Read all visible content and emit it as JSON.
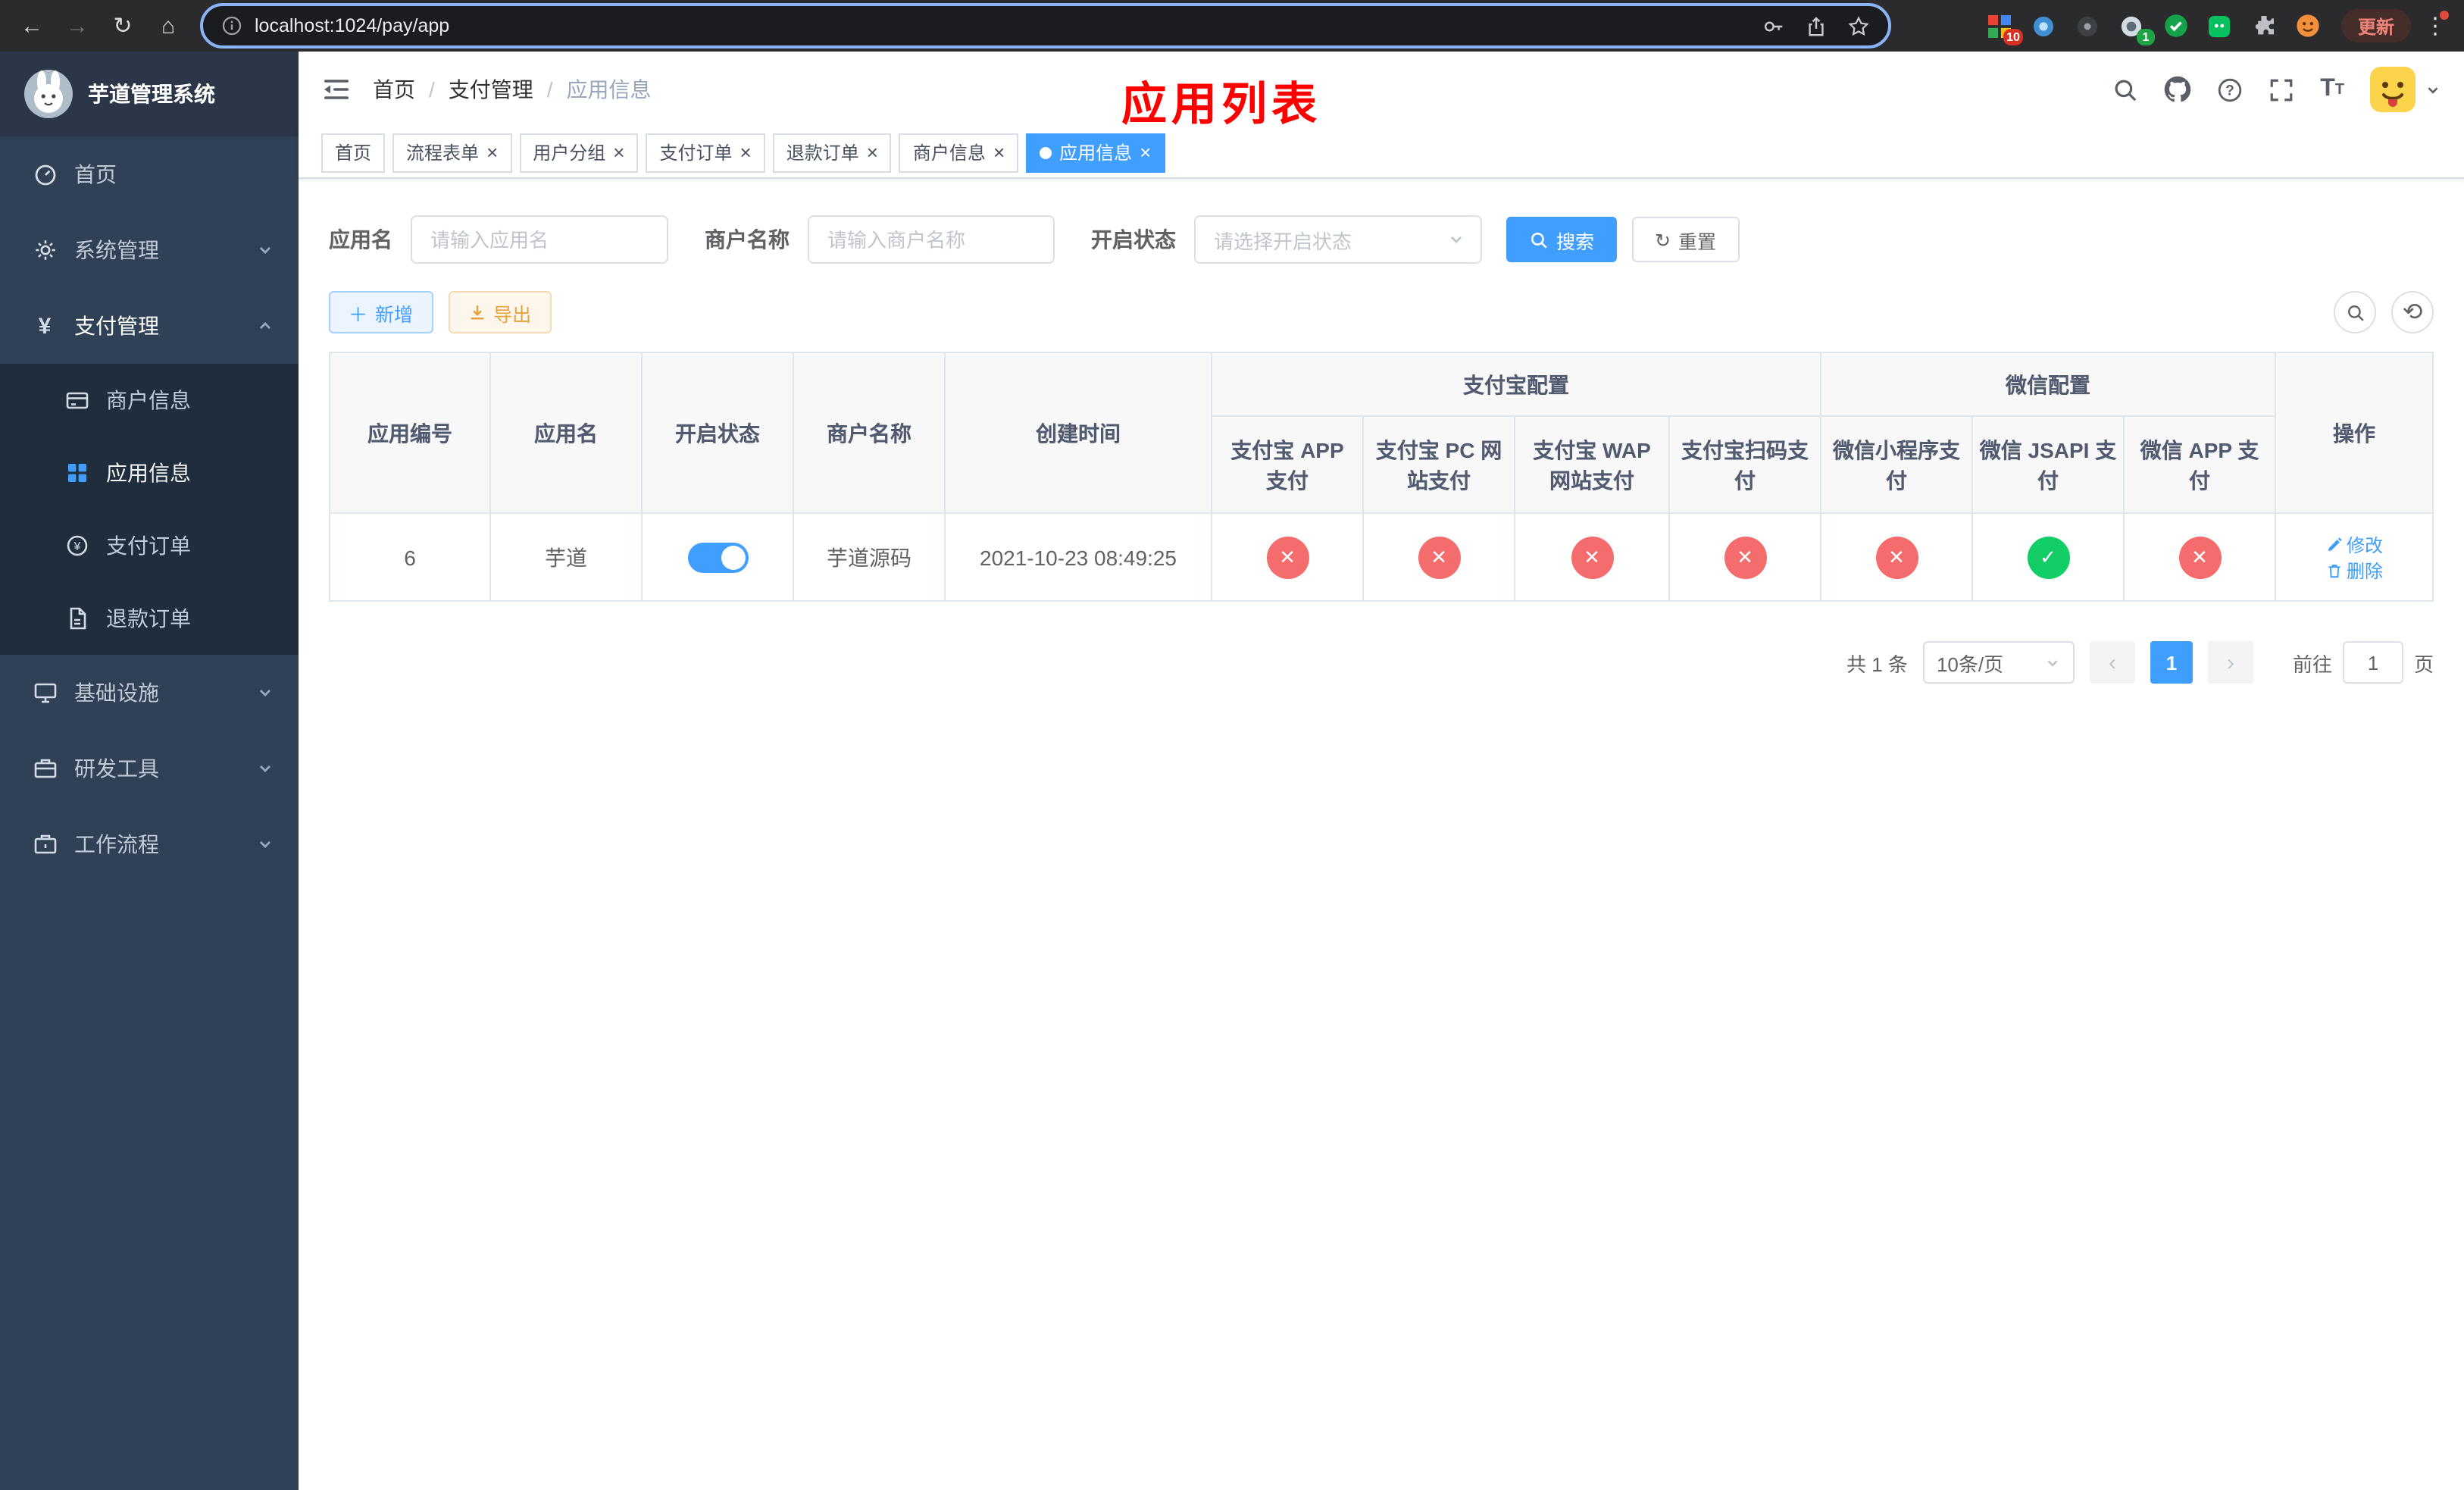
{
  "browser": {
    "url": "localhost:1024/pay/app",
    "update_button": "更新",
    "ext_badge_red": "10",
    "ext_badge_green": "1"
  },
  "sidebar": {
    "app_title": "芋道管理系统",
    "items": [
      {
        "label": "首页"
      },
      {
        "label": "系统管理"
      },
      {
        "label": "支付管理",
        "children": [
          {
            "label": "商户信息"
          },
          {
            "label": "应用信息"
          },
          {
            "label": "支付订单"
          },
          {
            "label": "退款订单"
          }
        ]
      },
      {
        "label": "基础设施"
      },
      {
        "label": "研发工具"
      },
      {
        "label": "工作流程"
      }
    ]
  },
  "header": {
    "breadcrumb": [
      "首页",
      "支付管理",
      "应用信息"
    ],
    "page_title": "应用列表"
  },
  "tags": [
    {
      "label": "首页"
    },
    {
      "label": "流程表单"
    },
    {
      "label": "用户分组"
    },
    {
      "label": "支付订单"
    },
    {
      "label": "退款订单"
    },
    {
      "label": "商户信息"
    },
    {
      "label": "应用信息"
    }
  ],
  "filters": {
    "app_name_label": "应用名",
    "app_name_placeholder": "请输入应用名",
    "merchant_label": "商户名称",
    "merchant_placeholder": "请输入商户名称",
    "status_label": "开启状态",
    "status_placeholder": "请选择开启状态",
    "search_button": "搜索",
    "reset_button": "重置"
  },
  "toolbar": {
    "add_button": "新增",
    "export_button": "导出"
  },
  "table": {
    "group_headers": {
      "alipay": "支付宝配置",
      "wechat": "微信配置"
    },
    "columns": [
      "应用编号",
      "应用名",
      "开启状态",
      "商户名称",
      "创建时间",
      "支付宝 APP 支付",
      "支付宝 PC 网站支付",
      "支付宝 WAP 网站支付",
      "支付宝扫码支付",
      "微信小程序支付",
      "微信 JSAPI 支付",
      "微信 APP 支付",
      "操作"
    ],
    "rows": [
      {
        "id": "6",
        "name": "芋道",
        "enabled": true,
        "merchant": "芋道源码",
        "created": "2021-10-23 08:49:25",
        "configs": [
          "error",
          "error",
          "error",
          "error",
          "error",
          "success",
          "error"
        ],
        "edit_label": "修改",
        "delete_label": "删除"
      }
    ]
  },
  "icons": {
    "success_glyph": "✓",
    "error_glyph": "✕"
  },
  "colors": {
    "primary": "#409EFF",
    "success": "#13ce66",
    "danger": "#f56c6c",
    "title_red": "#ff0000",
    "sidebar": "#304156"
  },
  "pagination": {
    "total_text": "共 1 条",
    "page_size": "10条/页",
    "prev_glyph": "‹",
    "next_glyph": "›",
    "current_page": "1",
    "goto_label": "前往",
    "goto_value": "1",
    "page_unit": "页"
  }
}
